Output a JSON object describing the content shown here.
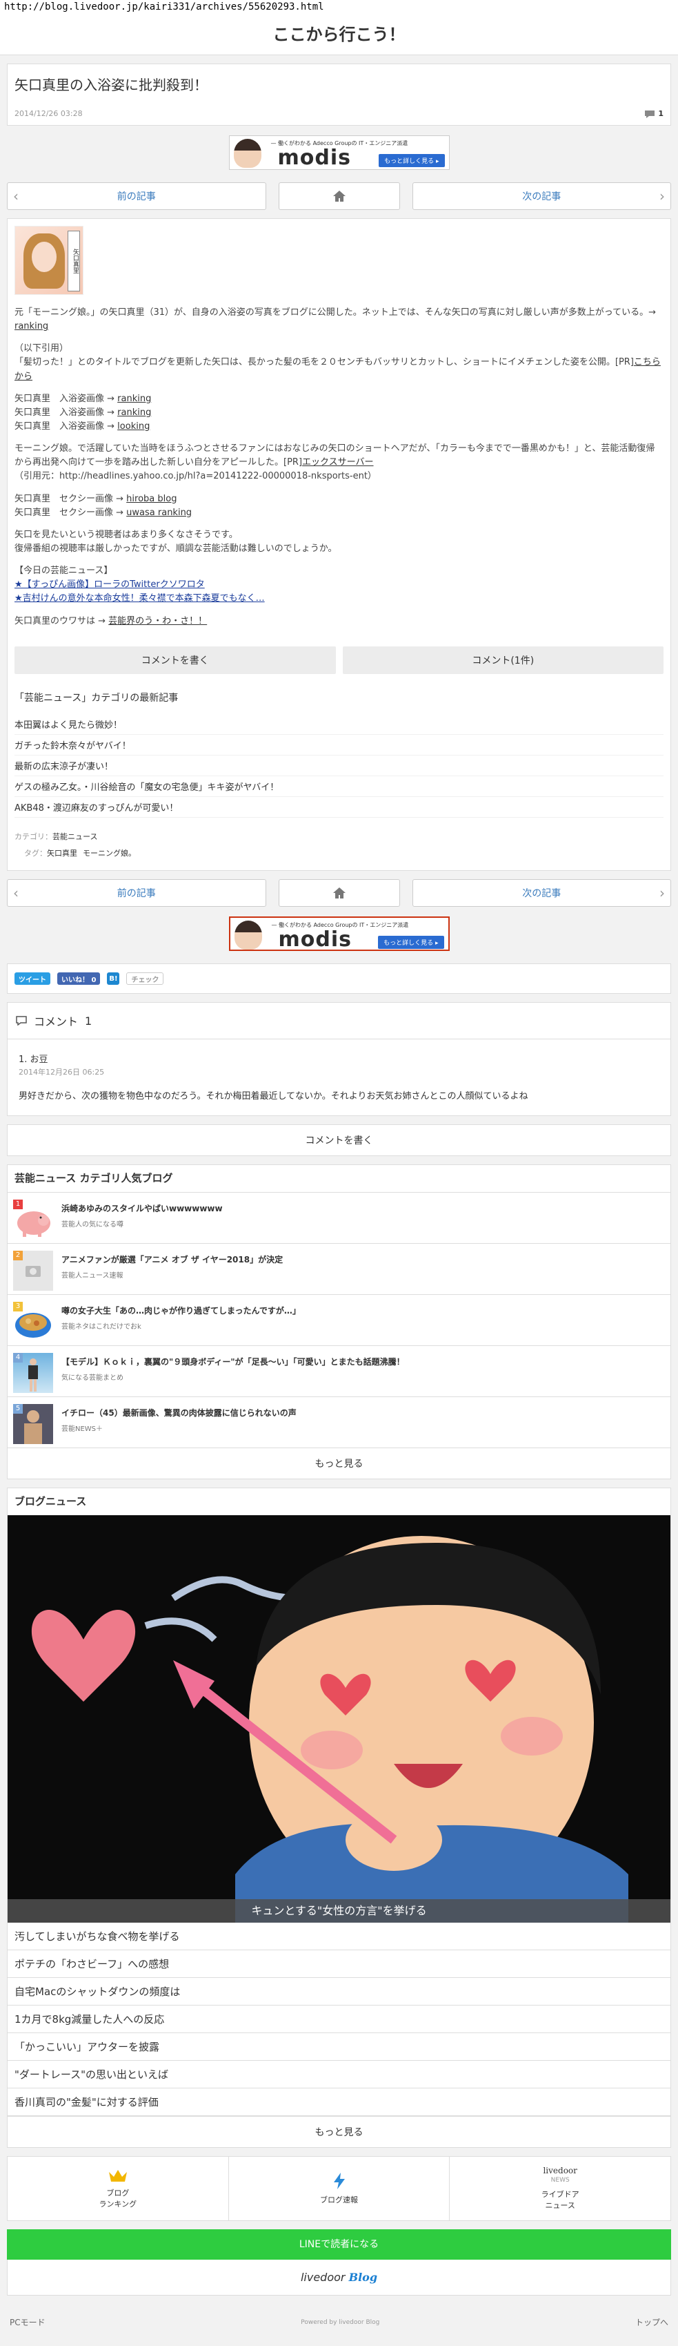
{
  "url": "http://blog.livedoor.jp/kairi331/archives/55620293.html",
  "site_title": "ここから行こう！",
  "article": {
    "title": "矢口真里の入浴姿に批判殺到！",
    "date": "2014/12/26 03:28",
    "comment_count": "1"
  },
  "banner": {
    "tagline": "— 働くがわかる Adecco Groupの IT・エンジニア派遣",
    "logo": "modis",
    "cta": "もっと詳しく見る ▸"
  },
  "pager": {
    "prev": "前の記事",
    "next": "次の記事"
  },
  "thumb_sig": "矢口真里",
  "body": {
    "p1": "元「モーニング娘。」の矢口真里（31）が、自身の入浴姿の写真をブログに公開した。ネット上では、そんな矢口の写真に対し厳しい声が多数上がっている。→",
    "p1_link": "ranking",
    "quote_head": "（以下引用）",
    "quote_text": "「髪切った！」とのタイトルでブログを更新した矢口は、長かった髪の毛を２０センチもバッサリとカットし、ショートにイメチェンした姿を公開。[PR]",
    "quote_link": "こちらから",
    "img_lines": [
      {
        "label": "矢口真里　入浴姿画像 →",
        "link": "ranking"
      },
      {
        "label": "矢口真里　入浴姿画像 →",
        "link": "ranking"
      },
      {
        "label": "矢口真里　入浴姿画像 →",
        "link": "looking"
      }
    ],
    "p3": "モーニング娘。で活躍していた当時をほうふつとさせるファンにはおなじみの矢口のショートヘアだが、「カラーも今までで一番黒めかも！」と、芸能活動復帰から再出発へ向けて一歩を踏み出した新しい自分をアピールした。[PR]",
    "p3_link": "エックスサーバー",
    "p3_src": "（引用元：http://headlines.yahoo.co.jp/hl?a=20141222-00000018-nksports-ent）",
    "sexy_lines": [
      {
        "label": "矢口真里　セクシー画像 →",
        "link": "hiroba blog"
      },
      {
        "label": "矢口真里　セクシー画像 →",
        "link": "uwasa ranking"
      }
    ],
    "p4a": "矢口を見たいという視聴者はあまり多くなさそうです。",
    "p4b": "復帰番組の視聴率は厳しかったですが、順調な芸能活動は難しいのでしょうか。",
    "today_head": "【今日の芸能ニュース】",
    "today_items": [
      "★【すっぴん画像】ローラのTwitterクソワロタ",
      "★吉村けんの意外な本命女性！柔々襟で本森下森夏でもなく…"
    ],
    "rumor_label": "矢口真里のウワサは →",
    "rumor_link": "芸能界のう・わ・さ！！"
  },
  "actions": {
    "write": "コメントを書く",
    "comments": "コメント(1件)"
  },
  "category_latest": {
    "heading": "「芸能ニュース」カテゴリの最新記事",
    "items": [
      "本田翼はよく見たら微妙！",
      "ガチった鈴木奈々がヤバイ！",
      "最新の広末涼子が凄い！",
      "ゲスの極み乙女。・川谷絵音の「魔女の宅急便」キキ姿がヤバイ！",
      "AKB48・渡辺麻友のすっぴんが可愛い！"
    ]
  },
  "taxonomy": {
    "category_label": "カテゴリ：",
    "category": "芸能ニュース",
    "tag_label": "タグ：",
    "tags": [
      "矢口真里",
      "モーニング娘。"
    ]
  },
  "social": {
    "tweet": "ツイート",
    "like": "いいね！ 0",
    "hatena": "B!",
    "check": "チェック"
  },
  "comments": {
    "heading": "コメント",
    "count": "1",
    "items": [
      {
        "author": "1. お豆",
        "date": "2014年12月26日 06:25",
        "text": "男好きだから、次の獲物を物色中なのだろう。それか梅田着最近してないか。それよりお天気お姉さんとこの人顔似ているよね"
      }
    ]
  },
  "write_comment": "コメントを書く",
  "popular": {
    "heading": "芸能ニュース カテゴリ人気ブログ",
    "items": [
      {
        "rank": "1",
        "title": "浜崎あゆみのスタイルやばいwwwwwww",
        "source": "芸能人の気になる噂"
      },
      {
        "rank": "2",
        "title": "アニメファンが厳選「アニメ オブ ザ イヤー2018」が決定",
        "source": "芸能人ニュース速報"
      },
      {
        "rank": "3",
        "title": "噂の女子大生「あの…肉じゃが作り過ぎてしまったんですが…」",
        "source": "芸能ネタはこれだけでおk"
      },
      {
        "rank": "4",
        "title": "【モデル】Ｋｏｋｉ，裏翼の\"９頭身ボディー\"が「足長～い」「可愛い」とまたも話題沸騰！",
        "source": "気になる芸能まとめ"
      },
      {
        "rank": "5",
        "title": "イチロー（45）最新画像、驚異の肉体披露に信じられないの声",
        "source": "芸能NEWS＋"
      }
    ],
    "more": "もっと見る"
  },
  "blognews": {
    "heading": "ブログニュース",
    "hero_caption": "キュンとする\"女性の方言\"を挙げる",
    "items": [
      "汚してしまいがちな食べ物を挙げる",
      "ポテチの「わさビーフ」への感想",
      "自宅Macのシャットダウンの頻度は",
      "1カ月で8kg減量した人への反応",
      "「かっこいい」アウターを披露",
      "\"ダートレース\"の思い出といえば",
      "香川真司の\"金髪\"に対する評価"
    ],
    "more": "もっと見る"
  },
  "footer_nav": {
    "ranking_line1": "ブログ",
    "ranking_line2": "ランキング",
    "flash": "ブログ速報",
    "news_logo1": "livedoor",
    "news_logo2": "NEWS",
    "news_line1": "ライブドア",
    "news_line2": "ニュース"
  },
  "line_button": "LINEで読者になる",
  "ld_logo": {
    "text": "livedoor",
    "blog": "Blog"
  },
  "bottom": {
    "pc_mode": "PCモード",
    "powered": "Powered by livedoor Blog",
    "top": "トップへ"
  },
  "colors": {
    "link_blue": "#3a7bbd",
    "line_green": "#2ecc40",
    "rank1": "#e83f3f",
    "rank2": "#f2a23a",
    "rank3": "#f2c23a"
  }
}
